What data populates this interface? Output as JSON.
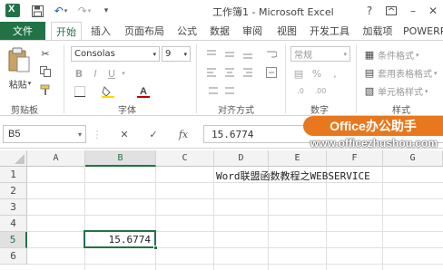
{
  "window": {
    "title": "工作簿1 - Microsoft Excel",
    "controls": {
      "help": "?",
      "minimize": "–",
      "restore": "▭",
      "close": "✕"
    }
  },
  "quick_access": [
    "save-icon",
    "undo-icon",
    "redo-icon",
    "customize-icon"
  ],
  "tabs": [
    "文件",
    "开始",
    "插入",
    "页面布局",
    "公式",
    "数据",
    "审阅",
    "视图",
    "开发工具",
    "加载项",
    "POWERP"
  ],
  "ribbon": {
    "clipboard": {
      "paste": "粘贴",
      "label": "剪贴板"
    },
    "font": {
      "name": "Consolas",
      "size": "9",
      "label": "字体",
      "bold": "B",
      "italic": "I",
      "underline": "U"
    },
    "alignment": {
      "label": "对齐方式"
    },
    "number": {
      "format": "常规",
      "label": "数字",
      "percent": "%"
    },
    "styles": {
      "conditional": "条件格式",
      "table": "套用表格格式",
      "cell": "单元格样式",
      "label": "样式"
    }
  },
  "formula_bar": {
    "name_box": "B5",
    "cancel": "✕",
    "enter": "✓",
    "fx": "fx",
    "value": "15.6774"
  },
  "watermark": {
    "badge": "Office办公助手",
    "url": "www.officezhushou.com"
  },
  "sheet": {
    "columns": [
      "A",
      "B",
      "C",
      "D",
      "E",
      "F",
      "G"
    ],
    "rows": [
      "1",
      "2",
      "3",
      "4",
      "5",
      "6"
    ],
    "cells": {
      "D1": "Word联盟函数教程之WEBSERVICE",
      "B5": "15.6774"
    },
    "selected": "B5",
    "accent": "#217346"
  }
}
